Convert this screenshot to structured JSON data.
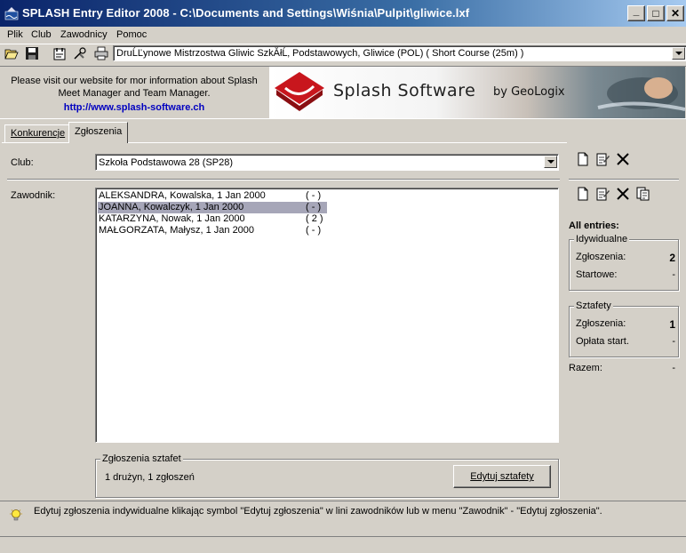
{
  "window": {
    "title": "SPLASH Entry Editor 2008 - C:\\Documents and Settings\\Wiśnia\\Pulpit\\gliwice.lxf",
    "min": "_",
    "max": "□",
    "close": "✕"
  },
  "menu": [
    "Plik",
    "Club",
    "Zawodnicy",
    "Pomoc"
  ],
  "toolbar": {
    "meet": "DruĹĽynowe Mistrzostwa Gliwic SzkĂłĹ‚ Podstawowych,  Gliwice  (POL)  ( Short Course (25m) )"
  },
  "banner": {
    "promo_line1": "Please visit our website for mor information about Splash",
    "promo_line2": "Meet Manager and Team Manager.",
    "link": "http://www.splash-software.ch",
    "logo_name": "Splash Software",
    "logo_by": "by GeoLogix"
  },
  "tabs": [
    "Konkurencje",
    "Zgłoszenia"
  ],
  "club": {
    "label": "Club:",
    "value": "Szkoła Podstawowa 28 (SP28)"
  },
  "swimmers": {
    "label": "Zawodnik:",
    "items": [
      {
        "name": "ALEKSANDRA, Kowalska, 1 Jan 2000",
        "count": "( - )"
      },
      {
        "name": "JOANNA, Kowalczyk, 1 Jan 2000",
        "count": "( - )"
      },
      {
        "name": "KATARZYNA, Nowak, 1 Jan 2000",
        "count": "( 2 )"
      },
      {
        "name": "MAŁGORZATA, Małysz, 1 Jan 2000",
        "count": "( - )"
      }
    ]
  },
  "relays": {
    "legend": "Zgłoszenia sztafet",
    "summary": "1 drużyn, 1 zgłoszeń",
    "button": "Edytuj sztafety"
  },
  "summary": {
    "title": "All entries:",
    "individual": {
      "legend": "Idywidualne",
      "entries_label": "Zgłoszenia:",
      "entries_value": "2",
      "starts_label": "Startowe:",
      "starts_value": "-"
    },
    "relay": {
      "legend": "Sztafety",
      "entries_label": "Zgłoszenia:",
      "entries_value": "1",
      "fee_label": "Opłata start.",
      "fee_value": "-"
    },
    "total_label": "Razem:",
    "total_value": "-"
  },
  "status": {
    "hint": "Edytuj zgłoszenia indywidualne klikając symbol \"Edytuj zgłoszenia\" w lini zawodników lub w menu \"Zawodnik\" - \"Edytuj zgłoszenia\"."
  },
  "colors": {
    "titlebar_start": "#0a246a",
    "face": "#d4d0c8",
    "link": "#0000c0",
    "selection": "#a6a6b8",
    "logo_red": "#c8161d"
  }
}
